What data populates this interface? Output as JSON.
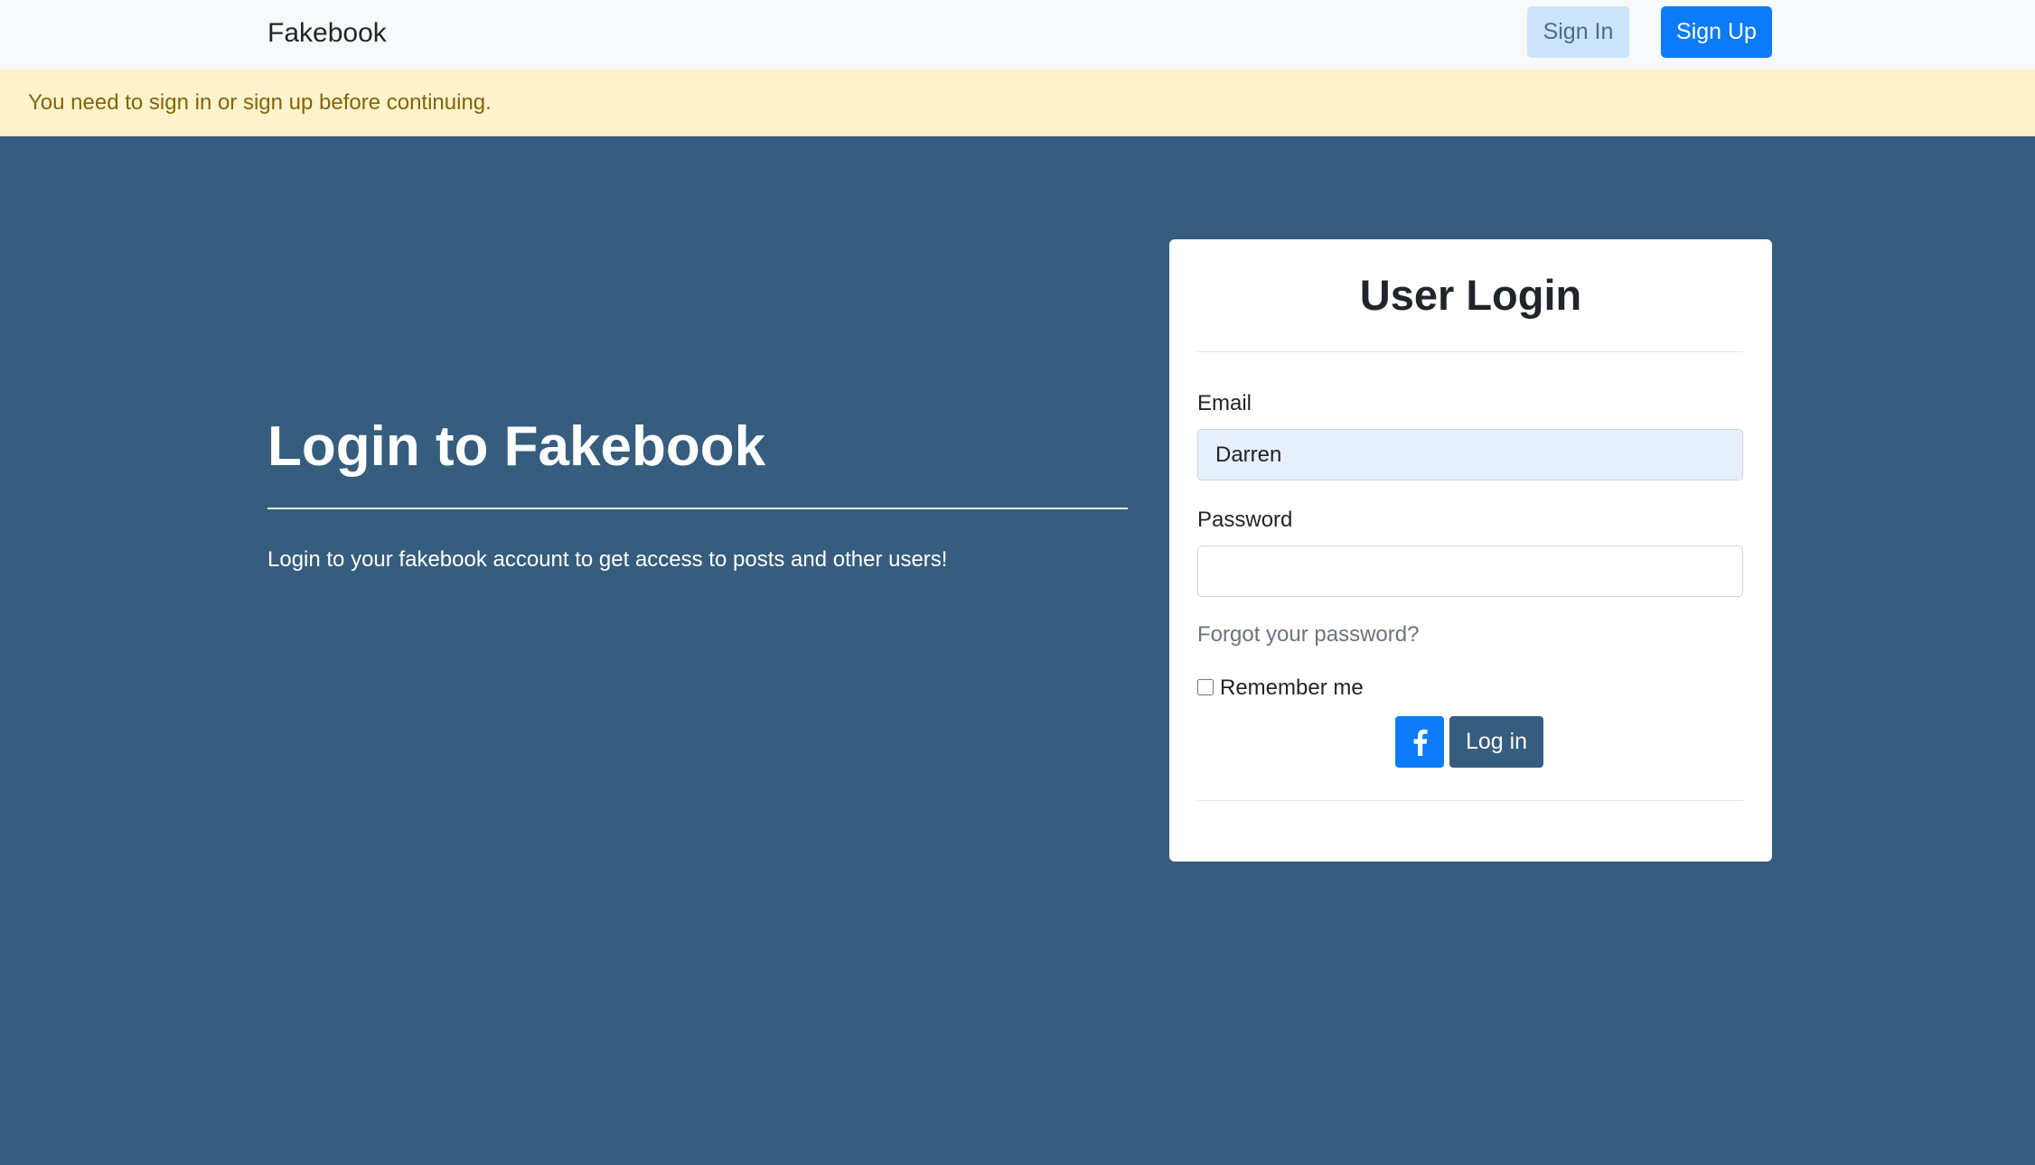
{
  "navbar": {
    "brand": "Fakebook",
    "sign_in_label": "Sign In",
    "sign_up_label": "Sign Up"
  },
  "alert": {
    "message": "You need to sign in or sign up before continuing."
  },
  "hero": {
    "title": "Login to Fakebook",
    "description": "Login to your fakebook account to get access to posts and other users!"
  },
  "login_card": {
    "title": "User Login",
    "email_label": "Email",
    "email_value": "Darren",
    "password_label": "Password",
    "password_value": "",
    "forgot_password_label": "Forgot your password?",
    "remember_me_label": "Remember me",
    "remember_me_checked": false,
    "facebook_icon": "facebook-f-icon",
    "login_button_label": "Log in"
  },
  "colors": {
    "page_background": "#365d7e",
    "navbar_background": "#f8f9fa",
    "alert_background": "#fff3cd",
    "alert_text": "#856404",
    "primary_button": "#0b7bfa",
    "sign_in_button": "#cce4fc",
    "login_button": "#365d7e",
    "autofill_input": "#e8f0fe"
  }
}
